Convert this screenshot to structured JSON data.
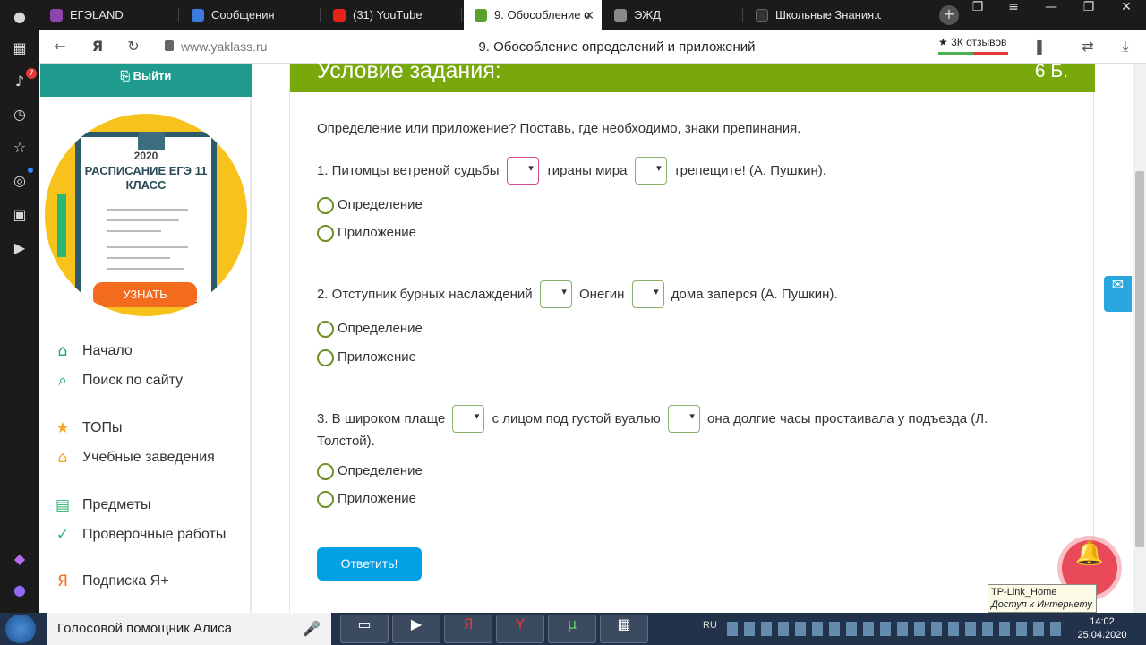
{
  "browser": {
    "tabs": [
      {
        "label": "ЕГЭLAND",
        "color": "#8e44ad"
      },
      {
        "label": "Сообщения",
        "color": "#3b7be0"
      },
      {
        "label": "(31) YouTube",
        "color": "#e62117"
      },
      {
        "label": "9. Обособление о",
        "color": "#5aa02c"
      },
      {
        "label": "ЭЖД",
        "color": "#888888"
      },
      {
        "label": "Школьные Знания.co",
        "color": "#333333"
      }
    ],
    "url": "www.yaklass.ru",
    "page_title": "9. Обособление определений и приложений",
    "reviews": "★ 3К отзывов",
    "notification_count": "7"
  },
  "sidebar": {
    "logout": "Выйти",
    "promo": {
      "year": "2020",
      "title": "РАСПИСАНИЕ ЕГЭ 11 КЛАСС",
      "button": "УЗНАТЬ"
    },
    "menu": [
      {
        "label": "Начало",
        "icon": "home-icon",
        "glyph": "⌂",
        "color": "#1f9b8e"
      },
      {
        "label": "Поиск по сайту",
        "icon": "search-icon",
        "glyph": "⌕",
        "color": "#1f9b8e"
      },
      {
        "label": "ТОПы",
        "icon": "star-icon",
        "glyph": "★",
        "color": "#f5a623"
      },
      {
        "label": "Учебные заведения",
        "icon": "institution-icon",
        "glyph": "⌂",
        "color": "#f5a623"
      },
      {
        "label": "Предметы",
        "icon": "book-icon",
        "glyph": "▤",
        "color": "#2bb673"
      },
      {
        "label": "Проверочные работы",
        "icon": "check-circle-icon",
        "glyph": "✓",
        "color": "#2bb673"
      },
      {
        "label": "Подписка Я+",
        "icon": "subscription-icon",
        "glyph": "Я",
        "color": "#f36b1c"
      }
    ]
  },
  "task": {
    "header": "Условие задания:",
    "points": "6 Б.",
    "instruction": "Определение или приложение? Поставь, где необходимо, знаки препинания.",
    "questions": [
      {
        "parts": [
          "1. Питомцы ветреной судьбы",
          "тираны мира",
          "трепещите! (А. Пушкин)."
        ],
        "options": [
          "Определение",
          "Приложение"
        ]
      },
      {
        "parts": [
          "2. Отступник бурных наслаждений",
          "Онегин",
          "дома заперся (А. Пушкин)."
        ],
        "options": [
          "Определение",
          "Приложение"
        ]
      },
      {
        "parts": [
          "3. В широком плаще",
          "с лицом под густой вуалью",
          "она долгие часы простаивала у подъезда (Л.",
          "Толстой)."
        ],
        "options": [
          "Определение",
          "Приложение"
        ]
      }
    ],
    "submit": "Ответить!"
  },
  "network_tooltip": {
    "name": "TP-Link_Home",
    "status": "Доступ к Интернету"
  },
  "taskbar": {
    "assistant": "Голосовой помощник Алиса",
    "language": "RU",
    "time": "14:02",
    "date": "25.04.2020"
  }
}
